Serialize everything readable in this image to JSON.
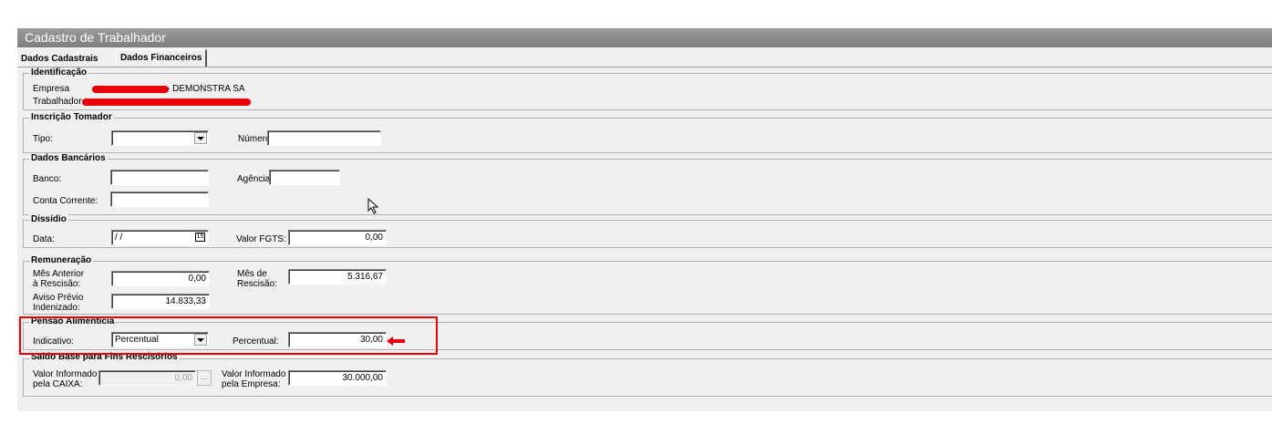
{
  "window": {
    "title": "Cadastro de Trabalhador"
  },
  "tabs": [
    {
      "label": "Dados Cadastrais",
      "active": false
    },
    {
      "label": "Dados Financeiros",
      "active": true
    }
  ],
  "identificacao": {
    "legend": "Identificação",
    "empresa_label": "Empresa",
    "empresa_value": "- DEMONSTRA SA",
    "trabalhador_label": "Trabalhador"
  },
  "inscricao": {
    "legend": "Inscrição Tomador",
    "tipo_label": "Tipo:",
    "tipo_value": "",
    "numero_label": "Número:",
    "numero_value": ""
  },
  "bancarios": {
    "legend": "Dados Bancários",
    "banco_label": "Banco:",
    "banco_value": "",
    "agencia_label": "Agência:",
    "agencia_value": "",
    "conta_label": "Conta Corrente:",
    "conta_value": ""
  },
  "dissidio": {
    "legend": "Dissídio",
    "data_label": "Data:",
    "data_value": " / /",
    "fgts_label": "Valor FGTS:",
    "fgts_value": "0,00"
  },
  "remuneracao": {
    "legend": "Remuneração",
    "mes_anterior_label_1": "Mês Anterior",
    "mes_anterior_label_2": "à Rescisão:",
    "mes_anterior_value": "0,00",
    "mes_rescisao_label_1": "Mês de",
    "mes_rescisao_label_2": "Rescisão:",
    "mes_rescisao_value": "5.316,67",
    "aviso_label_1": "Aviso Prévio",
    "aviso_label_2": "Indenizado:",
    "aviso_value": "14.833,33"
  },
  "pensao": {
    "legend": "Pensão Alimentícia",
    "indicativo_label": "Indicativo:",
    "indicativo_value": "Percentual",
    "percentual_label": "Percentual:",
    "percentual_value": "30,00"
  },
  "saldo": {
    "legend": "Saldo Base para Fins Rescisórios",
    "caixa_label_1": "Valor Informado",
    "caixa_label_2": "pela CAIXA:",
    "caixa_value": "0,00",
    "caixa_button": "...",
    "empresa_label_1": "Valor Informado",
    "empresa_label_2": "pela Empresa:",
    "empresa_value": "30.000,00"
  },
  "colors": {
    "highlight": "#e8000a",
    "titlebar": "#8c8c8c"
  },
  "icons": {
    "dropdown": "chevron-down-icon",
    "calendar": "calendar-icon",
    "cursor": "mouse-pointer-icon",
    "arrow": "red-arrow-icon"
  }
}
